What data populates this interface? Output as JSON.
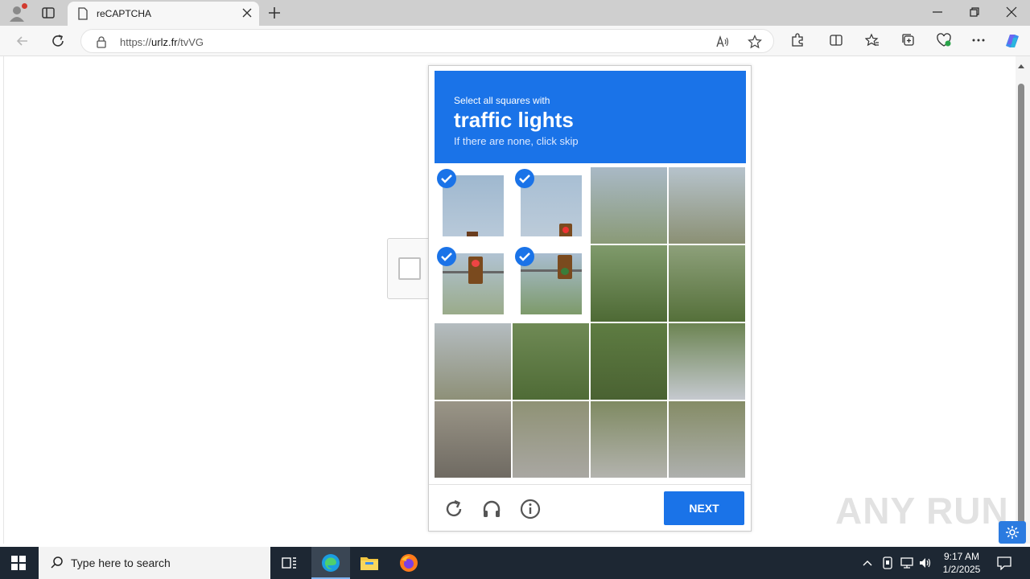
{
  "browser": {
    "tab_title": "reCAPTCHA",
    "url_prefix": "https://",
    "url_host": "urlz.fr",
    "url_path": "/tvVG"
  },
  "captcha": {
    "instruction_small": "Select all squares with",
    "target_object": "traffic lights",
    "instruction_skip": "If there are none, click skip",
    "next_label": "NEXT",
    "grid_rows": 4,
    "grid_cols": 4,
    "selected_tiles": [
      "row1-col1",
      "row1-col2",
      "row2-col1",
      "row2-col2"
    ],
    "icons": [
      "reload-icon",
      "audio-headphones-icon",
      "info-icon"
    ]
  },
  "watermark": "ANY RUN",
  "taskbar": {
    "search_placeholder": "Type here to search",
    "time": "9:17 AM",
    "date": "1/2/2025"
  },
  "colors": {
    "accent": "#1a73e8",
    "taskbar": "#1d2733",
    "chrome": "#cfcfcf"
  }
}
